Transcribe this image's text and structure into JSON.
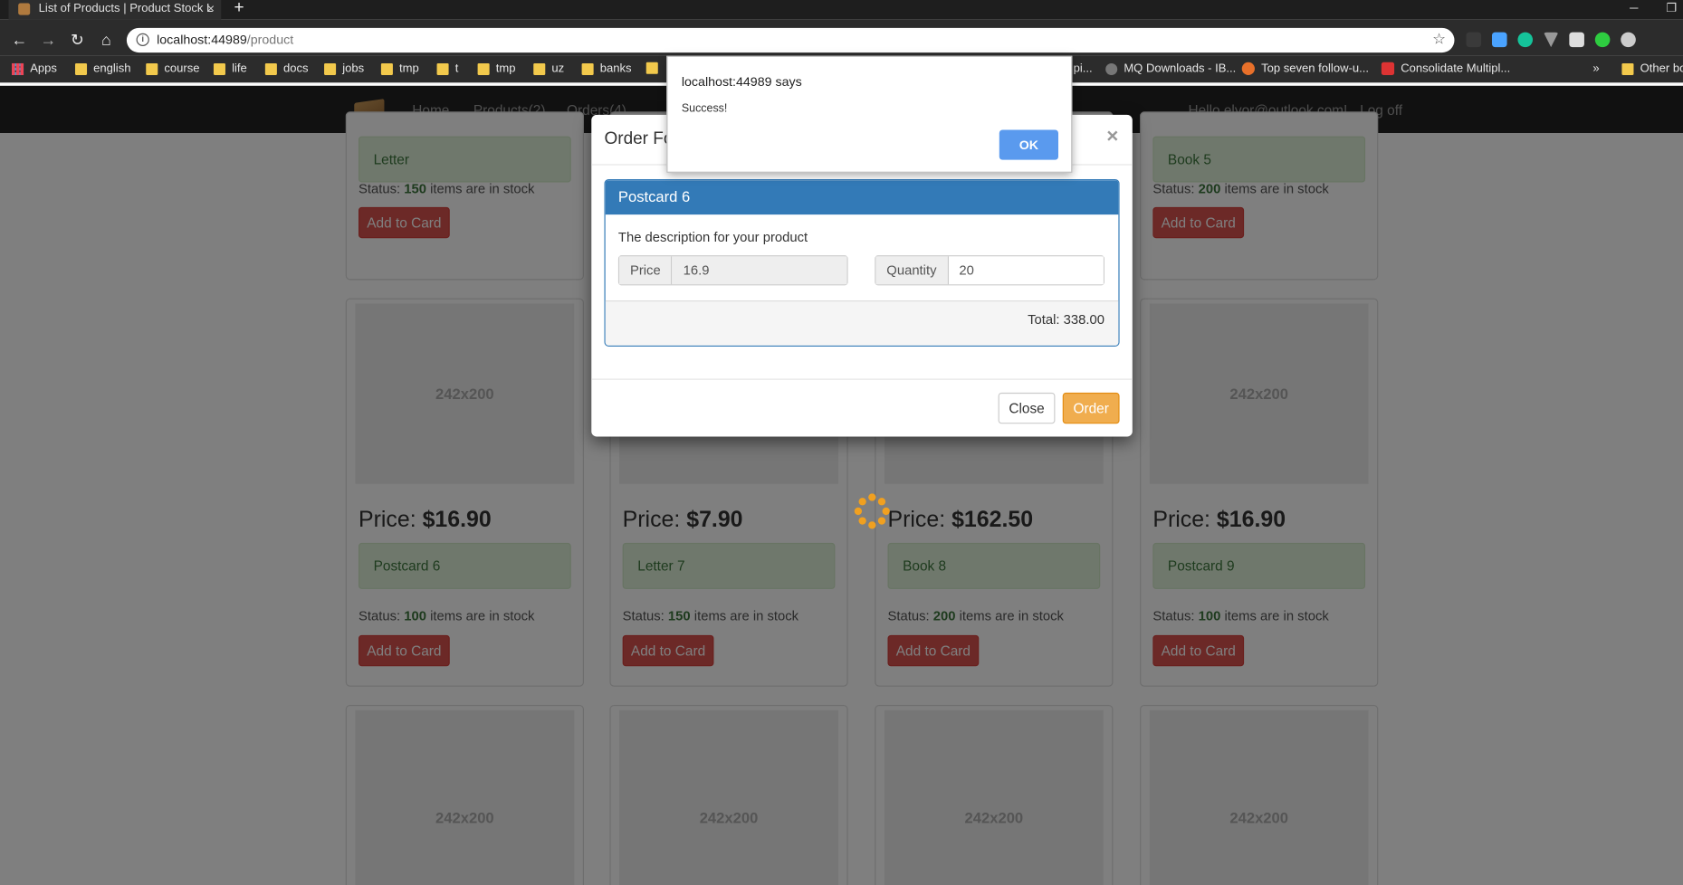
{
  "browser": {
    "tab_title": "List of Products | Product Stock L",
    "tab_close": "×",
    "new_tab": "+",
    "url_host": "localhost:44989",
    "url_path": "/product",
    "bookmarks": [
      "Apps",
      "english",
      "course",
      "life",
      "docs",
      "jobs",
      "tmp",
      "t",
      "tmp",
      "uz",
      "banks"
    ],
    "bookmarks_right": [
      "MQ Downloads - IB...",
      "Top seven follow-u...",
      "Consolidate Multipl..."
    ],
    "bookmarks_partial": "pi...",
    "bookmarks_overflow": "»",
    "other_bookmarks": "Other bo"
  },
  "navbar": {
    "links": [
      "Home",
      "Products(2)",
      "Orders(4)"
    ],
    "user": "Hello elyor@outlook.com!",
    "logoff": "Log off"
  },
  "products": [
    {
      "name": "Letter",
      "status_count": "150",
      "status_suffix": "items are in stock",
      "button": "Add to Card"
    },
    {
      "name": "Book 5",
      "status_count": "200",
      "status_suffix": "items are in stock",
      "button": "Add to Card"
    },
    {
      "thumb": "242x200",
      "price_label": "Price:",
      "price": "$16.90",
      "name": "Postcard 6",
      "status_count": "100",
      "status_suffix": "items are in stock",
      "button": "Add to Card"
    },
    {
      "thumb": "242x200",
      "price_label": "Price:",
      "price": "$7.90",
      "name": "Letter 7",
      "status_count": "150",
      "status_suffix": "items are in stock",
      "button": "Add to Card"
    },
    {
      "thumb": "242x200",
      "price_label": "Price:",
      "price": "$162.50",
      "name": "Book 8",
      "status_count": "200",
      "status_suffix": "items are in stock",
      "button": "Add to Card"
    },
    {
      "thumb": "242x200",
      "price_label": "Price:",
      "price": "$16.90",
      "name": "Postcard 9",
      "status_count": "100",
      "status_suffix": "items are in stock",
      "button": "Add to Card"
    },
    {
      "thumb": "242x200"
    },
    {
      "thumb": "242x200"
    },
    {
      "thumb": "242x200"
    },
    {
      "thumb": "242x200"
    }
  ],
  "status_prefix": "Status:",
  "modal": {
    "title": "Order Fo",
    "close_x": "×",
    "panel_title": "Postcard 6",
    "description": "The description for your product",
    "price_label": "Price",
    "price_value": "16.9",
    "quantity_label": "Quantity",
    "quantity_value": "20",
    "total": "Total: 338.00",
    "close_button": "Close",
    "order_button": "Order"
  },
  "alert": {
    "origin": "localhost:44989 says",
    "message": "Success!",
    "ok": "OK"
  },
  "colors": {
    "accent": "#337ab7",
    "danger": "#d9534f",
    "warning": "#f0ad4e",
    "success_bg": "#dff0d8"
  }
}
